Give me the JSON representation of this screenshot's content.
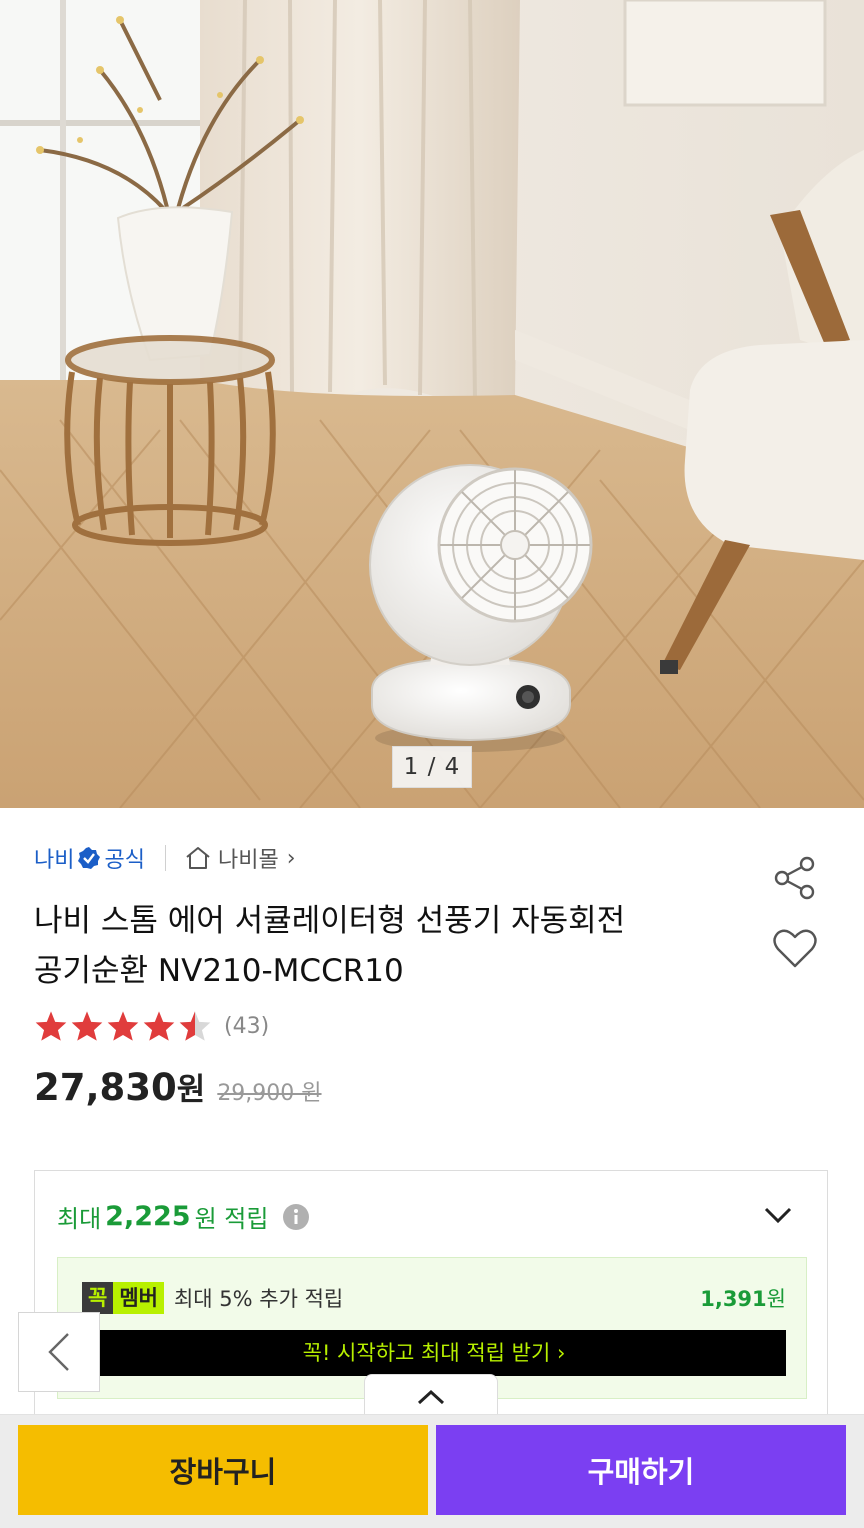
{
  "gallery": {
    "page_indicator": "1 / 4"
  },
  "brand": {
    "name": "나비",
    "official_label": "공식",
    "store_link": "나비몰",
    "store_chevron": "›"
  },
  "product": {
    "title_line1": "나비 스톰 에어 서큘레이터형 선풍기 자동회전",
    "title_line2": "공기순환 NV210-MCCR10",
    "rating": 4.5,
    "review_count": "(43)",
    "price": "27,830",
    "price_unit": "원",
    "original_price": "29,900 원"
  },
  "reward": {
    "prefix": "최대",
    "amount": "2,225",
    "suffix": "원 적립",
    "member_badge_a": "꼭",
    "member_badge_b": "멤버",
    "member_text": "최대 5% 추가 적립",
    "member_amount": "1,391",
    "member_amount_unit": "원",
    "member_cta": "꼭! 시작하고 최대 적립 받기 ›"
  },
  "actions": {
    "cart_label": "장바구니",
    "buy_label": "구매하기"
  },
  "colors": {
    "accent_blue": "#1b5ec7",
    "reward_green": "#1a9b38",
    "cart_yellow": "#f5bd00",
    "buy_purple": "#7b3ff2",
    "star_red": "#e03c3c"
  },
  "icons": [
    "verified-icon",
    "home-icon",
    "share-icon",
    "heart-icon",
    "star-icon",
    "info-icon",
    "chevron-down-icon",
    "chevron-left-icon",
    "chevron-up-icon"
  ]
}
